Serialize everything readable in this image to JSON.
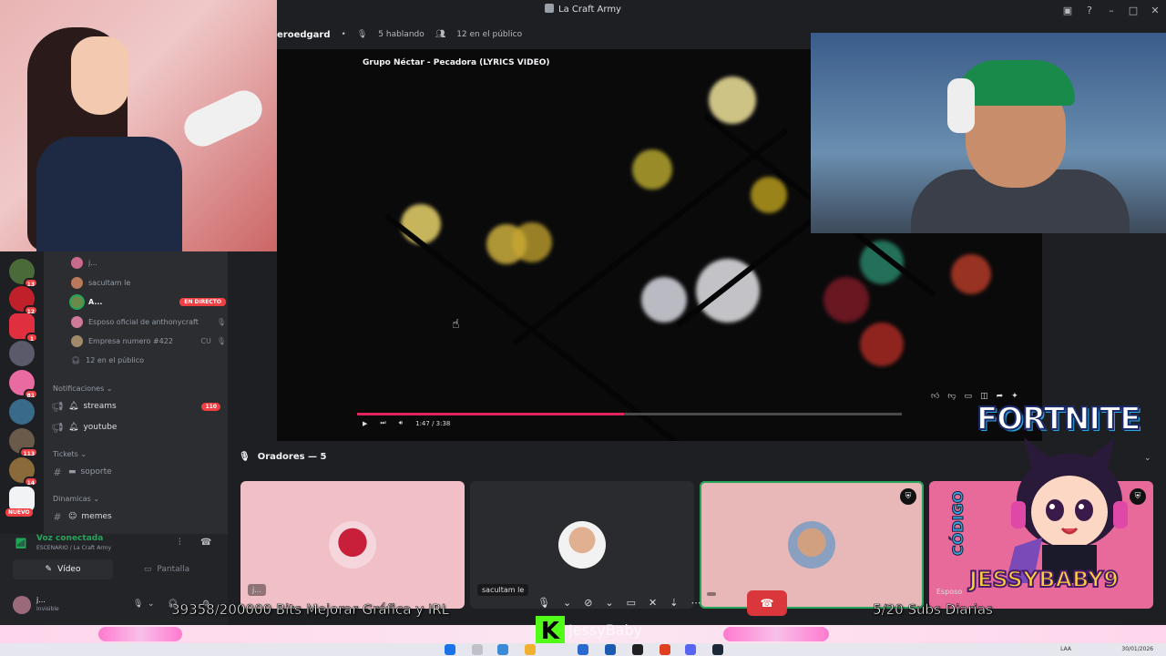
{
  "window": {
    "title": "La Craft Army"
  },
  "stage": {
    "channel": "eroedgard",
    "speaking": "5 hablando",
    "audience": "12 en el público"
  },
  "video": {
    "title": "Grupo Néctar - Pecadora (LYRICS VIDEO)",
    "time": "1:47 / 3:38",
    "progress": 0.49
  },
  "rail": {
    "badges": [
      "13",
      "12",
      "1",
      "81",
      "113",
      "14"
    ],
    "new_label": "NUEVO"
  },
  "members": [
    {
      "name": "j...",
      "tag": ""
    },
    {
      "name": "sacultam le",
      "tag": ""
    },
    {
      "name": "A...",
      "tag": "EN DIRECTO"
    },
    {
      "name": "Esposo oficial de anthonycraft",
      "tag": ""
    },
    {
      "name": "Empresa numero #422",
      "tag": "CU"
    }
  ],
  "audience_row": "12 en el público",
  "categories": {
    "notificaciones": "Notificaciones",
    "tickets": "Tickets",
    "dinamicas": "Dinamicas"
  },
  "channels": {
    "streams": {
      "label": "streams",
      "count": "110"
    },
    "youtube": {
      "label": "youtube"
    },
    "soporte": {
      "label": "soporte"
    },
    "memes": {
      "label": "memes"
    }
  },
  "voice": {
    "status": "Voz conectada",
    "location": "ESCENARIO / La Craft Army",
    "video_btn": "Vídeo",
    "screen_btn": "Pantalla"
  },
  "user": {
    "name": "j...",
    "status": "Invisible"
  },
  "speakers": {
    "title": "Oradores — 5",
    "tiles": [
      {
        "name": "j..."
      },
      {
        "name": "sacultam le"
      },
      {
        "name": ""
      },
      {
        "name": "Esposo"
      }
    ]
  },
  "overlays": {
    "bits": "39358/200000 Bits Mejorar Gráfica y IRL",
    "subs": "5/20 Subs Diarias",
    "kick_name": "JessyBaby",
    "promo_title": "FORTNITE",
    "promo_codigo": "CÓDIGO",
    "promo_code": "JESSYBABY9"
  },
  "taskbar": {
    "lang": "LAA",
    "date": "30/01/2026"
  },
  "colors": {
    "accent_green": "#23a559",
    "danger": "#f23f43",
    "kick": "#53fc18"
  }
}
